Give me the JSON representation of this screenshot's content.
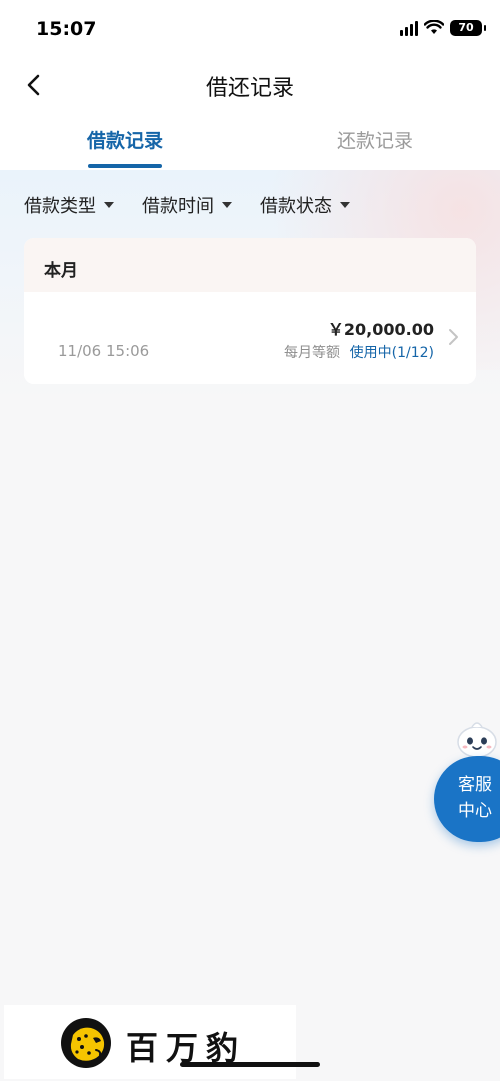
{
  "status_bar": {
    "time": "15:07",
    "battery": "70"
  },
  "nav": {
    "title": "借还记录"
  },
  "tabs": [
    {
      "label": "借款记录",
      "active": true
    },
    {
      "label": "还款记录",
      "active": false
    }
  ],
  "filters": [
    {
      "label": "借款类型"
    },
    {
      "label": "借款时间"
    },
    {
      "label": "借款状态"
    }
  ],
  "records_section": {
    "month_label": "本月",
    "items": [
      {
        "datetime": "11/06 15:06",
        "amount": "￥20,000.00",
        "plan": "每月等额",
        "status": "使用中(1/12)"
      }
    ]
  },
  "service": {
    "label": "客服中心"
  },
  "brand": {
    "name": "百万豹"
  },
  "colors": {
    "accent": "#1565a8",
    "service_button": "#1a74c6"
  }
}
